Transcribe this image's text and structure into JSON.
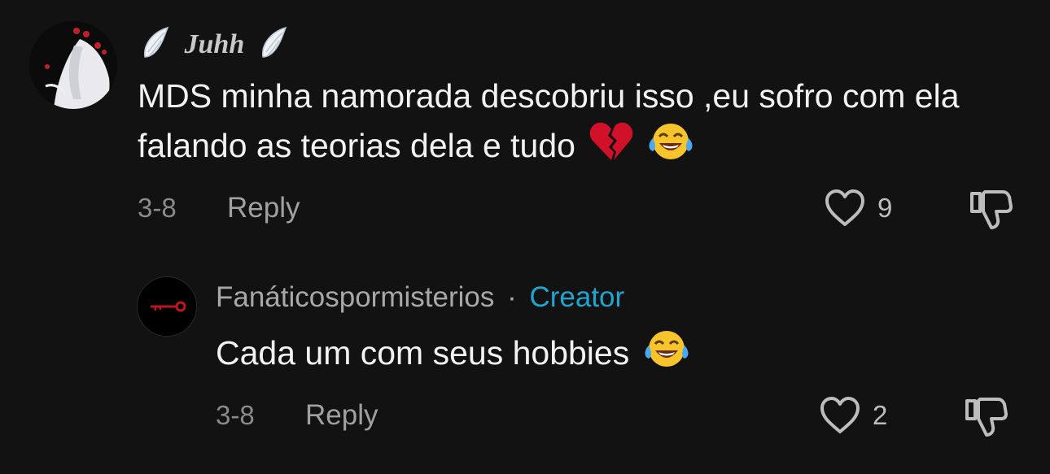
{
  "comment": {
    "username": "Juhh",
    "text": "MDS minha namorada descobriu isso ,eu sofro com ela falando as teorias dela e tudo",
    "date": "3-8",
    "reply_label": "Reply",
    "like_count": "9",
    "emojis": [
      "broken-heart",
      "tears-of-joy"
    ]
  },
  "reply": {
    "username": "Fanáticospormisterios",
    "separator": "·",
    "badge": "Creator",
    "text": "Cada um com seus hobbies",
    "date": "3-8",
    "reply_label": "Reply",
    "like_count": "2",
    "emojis": [
      "tears-of-joy"
    ]
  },
  "colors": {
    "background": "#121212",
    "creator_accent": "#20a4d0",
    "icon_gray": "#bdbdbd"
  }
}
